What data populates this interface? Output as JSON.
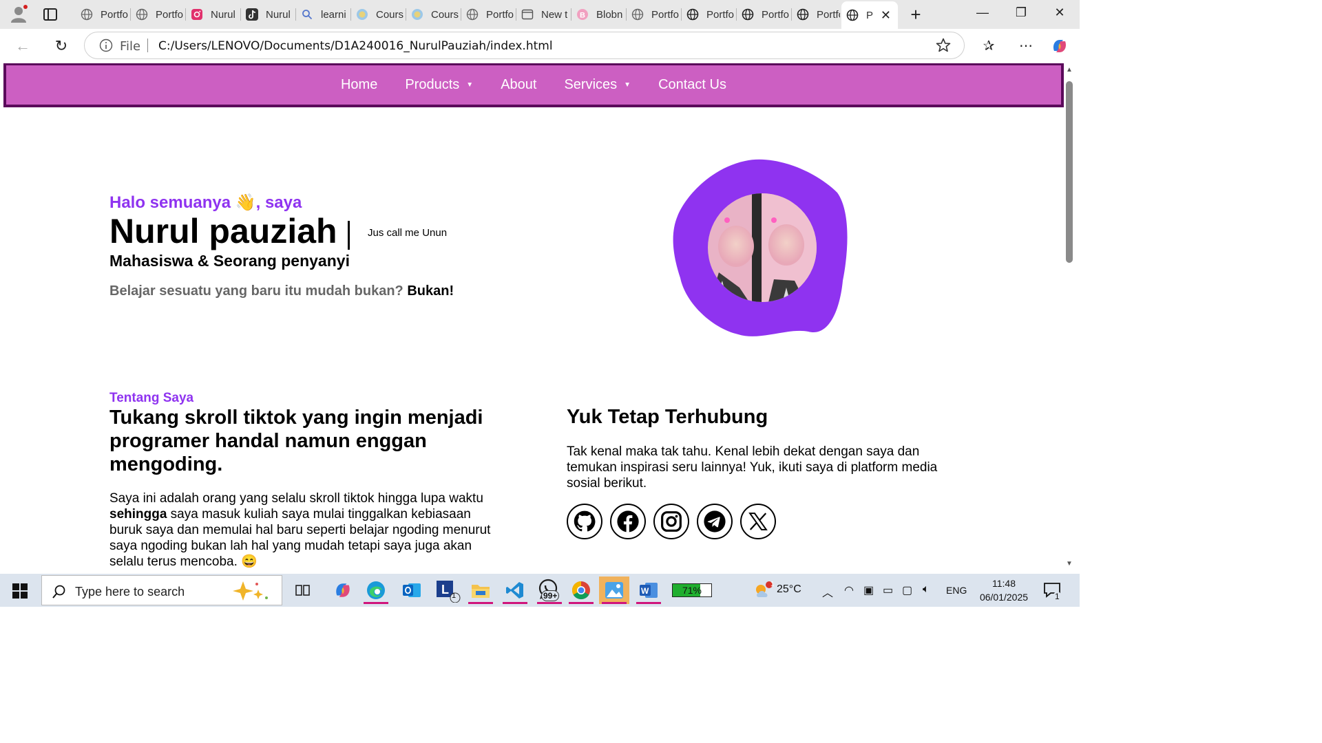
{
  "browser": {
    "tabs": [
      {
        "label": "Portfo",
        "icon": "globe-icon"
      },
      {
        "label": "Portfo",
        "icon": "globe-icon"
      },
      {
        "label": "Nurul",
        "icon": "instagram-icon"
      },
      {
        "label": "Nurul",
        "icon": "tiktok-icon"
      },
      {
        "label": "learni",
        "icon": "search-icon"
      },
      {
        "label": "Cours",
        "icon": "course-icon"
      },
      {
        "label": "Cours",
        "icon": "course-icon"
      },
      {
        "label": "Portfo",
        "icon": "globe-icon"
      },
      {
        "label": "New t",
        "icon": "newtab-icon"
      },
      {
        "label": "Blobn",
        "icon": "blobmaker-icon"
      },
      {
        "label": "Portfo",
        "icon": "globe-icon"
      },
      {
        "label": "Portfo",
        "icon": "globe-icon"
      },
      {
        "label": "Portfo",
        "icon": "globe-icon"
      },
      {
        "label": "Portfo",
        "icon": "globe-icon"
      },
      {
        "label": "P",
        "icon": "globe-icon"
      }
    ],
    "address": {
      "scheme_label": "File",
      "url": "C:/Users/LENOVO/Documents/D1A240016_NurulPauziah/index.html"
    }
  },
  "page": {
    "nav": [
      {
        "label": "Home",
        "dropdown": false
      },
      {
        "label": "Products",
        "dropdown": true,
        "caret": "▼"
      },
      {
        "label": "About",
        "dropdown": false
      },
      {
        "label": "Services",
        "dropdown": true,
        "caret": "▼"
      },
      {
        "label": "Contact Us",
        "dropdown": false
      }
    ],
    "hero": {
      "greeting": "Halo semuanya 👋, saya",
      "name": "Nurul pauziah",
      "nickname": "Jus call me Unun",
      "role": "Mahasiswa & Seorang penyanyi",
      "tagline": "Belajar sesuatu yang baru itu mudah bukan?",
      "tagline_answer": "Bukan!"
    },
    "about": {
      "label": "Tentang Saya",
      "title": "Tukang skroll tiktok yang ingin menjadi programer handal namun enggan mengoding.",
      "body_start": "Saya ini adalah orang yang selalu skroll tiktok hingga lupa waktu ",
      "body_bold": "sehingga",
      "body_end": " saya masuk kuliah saya mulai tinggalkan kebiasaan buruk saya dan memulai hal baru seperti belajar ngoding menurut saya ngoding bukan lah hal yang mudah tetapi saya juga akan selalu terus mencoba. 😄"
    },
    "contact": {
      "title": "Yuk Tetap Terhubung",
      "body": "Tak kenal maka tak tahu. Kenal lebih dekat dengan saya dan temukan inspirasi seru lainnya! Yuk, ikuti saya di platform media sosial berikut.",
      "socials": [
        "github-icon",
        "facebook-icon",
        "instagram-icon",
        "telegram-icon",
        "x-icon"
      ]
    },
    "colors": {
      "nav_bg": "#cc5fc2",
      "nav_border": "#5b0a5b",
      "accent": "#8f33f0",
      "blob": "#8f33f0"
    }
  },
  "taskbar": {
    "search_placeholder": "Type here to search",
    "battery": "71%",
    "weather": "25°C",
    "weather_badge": "1",
    "language": "ENG",
    "time": "11:48",
    "date": "06/01/2025",
    "notifications": "1",
    "whatsapp_badge": "99+",
    "launcher_badge": "1"
  }
}
